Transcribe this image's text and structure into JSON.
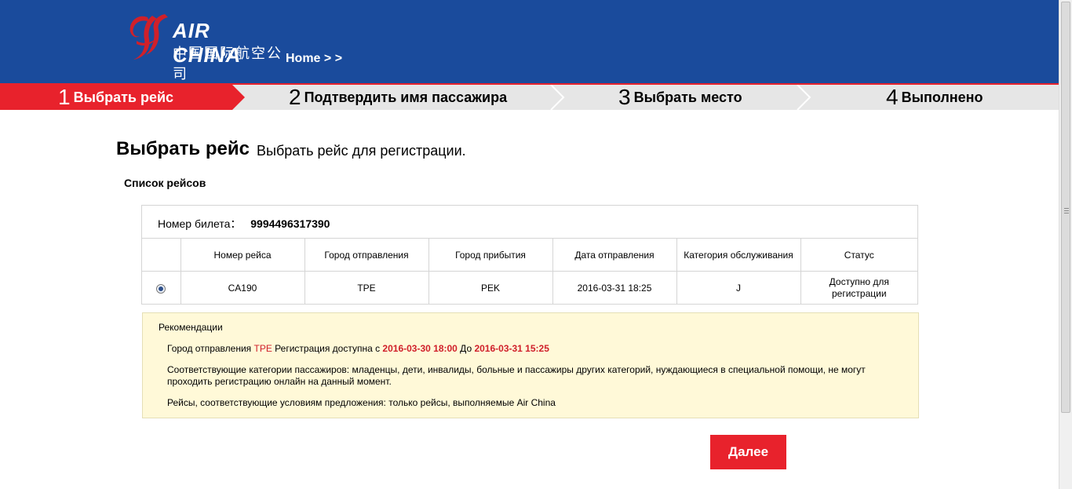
{
  "header": {
    "logo_en": "AIR CHINA",
    "logo_cn": "中国国际航空公司",
    "breadcrumb": "Home > >",
    "brand_color": "#1a4b9c"
  },
  "steps": [
    {
      "num": "1",
      "label": "Выбрать рейс",
      "active": true
    },
    {
      "num": "2",
      "label": "Подтвердить имя пассажира",
      "active": false
    },
    {
      "num": "3",
      "label": "Выбрать место",
      "active": false
    },
    {
      "num": "4",
      "label": "Выполнено",
      "active": false
    }
  ],
  "accent_color": "#e8222c",
  "page": {
    "title": "Выбрать рейс",
    "subtitle": "Выбрать рейс для регистрации.",
    "section_title": "Список рейсов"
  },
  "ticket": {
    "label": "Номер билета：",
    "number": "9994496317390"
  },
  "table": {
    "headers": [
      "",
      "Номер рейса",
      "Город отправления",
      "Город прибытия",
      "Дата отправления",
      "Категория обслуживания",
      "Статус"
    ],
    "rows": [
      {
        "selected": true,
        "flight": "CA190",
        "from": "TPE",
        "to": "PEK",
        "date": "2016-03-31 18:25",
        "class": "J",
        "status": "Доступно для регистрации"
      }
    ]
  },
  "recommendations": {
    "title": "Рекомендации",
    "line1": {
      "p1": "Город отправления ",
      "city": "TPE",
      "p2": " Регистрация доступна с ",
      "from": "2016-03-30 18:00",
      "p3": " До ",
      "to": "2016-03-31 15:25"
    },
    "line2": "Соответствующие категории пассажиров: младенцы, дети, инвалиды, больные и пассажиры других категорий, нуждающиеся в специальной помощи, не могут проходить регистрацию онлайн на данный момент.",
    "line3": "Рейсы, соответствующие условиям предложения: только рейсы, выполняемые Air China"
  },
  "next_button": "Далее"
}
